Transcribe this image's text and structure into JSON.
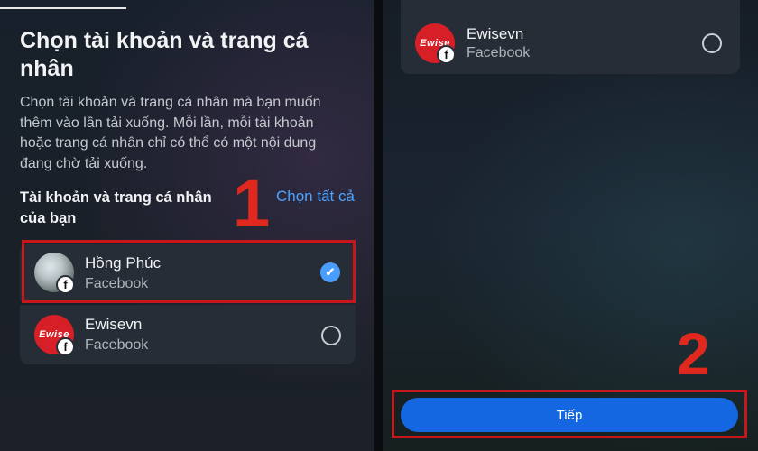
{
  "left_screen": {
    "title": "Chọn tài khoản và trang cá nhân",
    "description": "Chọn tài khoản và trang cá nhân mà bạn muốn thêm vào lần tải xuống. Mỗi lần, mỗi tài khoản hoặc trang cá nhân chỉ có thể có một nội dung đang chờ tải xuống.",
    "section_title": "Tài khoản và trang cá nhân của bạn",
    "select_all_label": "Chọn tất cả",
    "step_marker": "1",
    "accounts": [
      {
        "name": "Hồng Phúc",
        "platform": "Facebook",
        "selected": true,
        "avatar": "profile-photo"
      },
      {
        "name": "Ewisevn",
        "platform": "Facebook",
        "selected": false,
        "avatar": "ewise-logo",
        "logo_text": "Ewise"
      }
    ]
  },
  "right_screen": {
    "account": {
      "name": "Ewisevn",
      "platform": "Facebook",
      "selected": false,
      "avatar": "ewise-logo",
      "logo_text": "Ewise"
    },
    "step_marker": "2",
    "next_button_label": "Tiếp"
  },
  "icons": {
    "facebook_badge": "f",
    "check": "✔"
  },
  "colors": {
    "accent": "#4aa3ff",
    "primary_button": "#1467e0",
    "highlight": "#c8171b",
    "logo": "#d61f26"
  }
}
